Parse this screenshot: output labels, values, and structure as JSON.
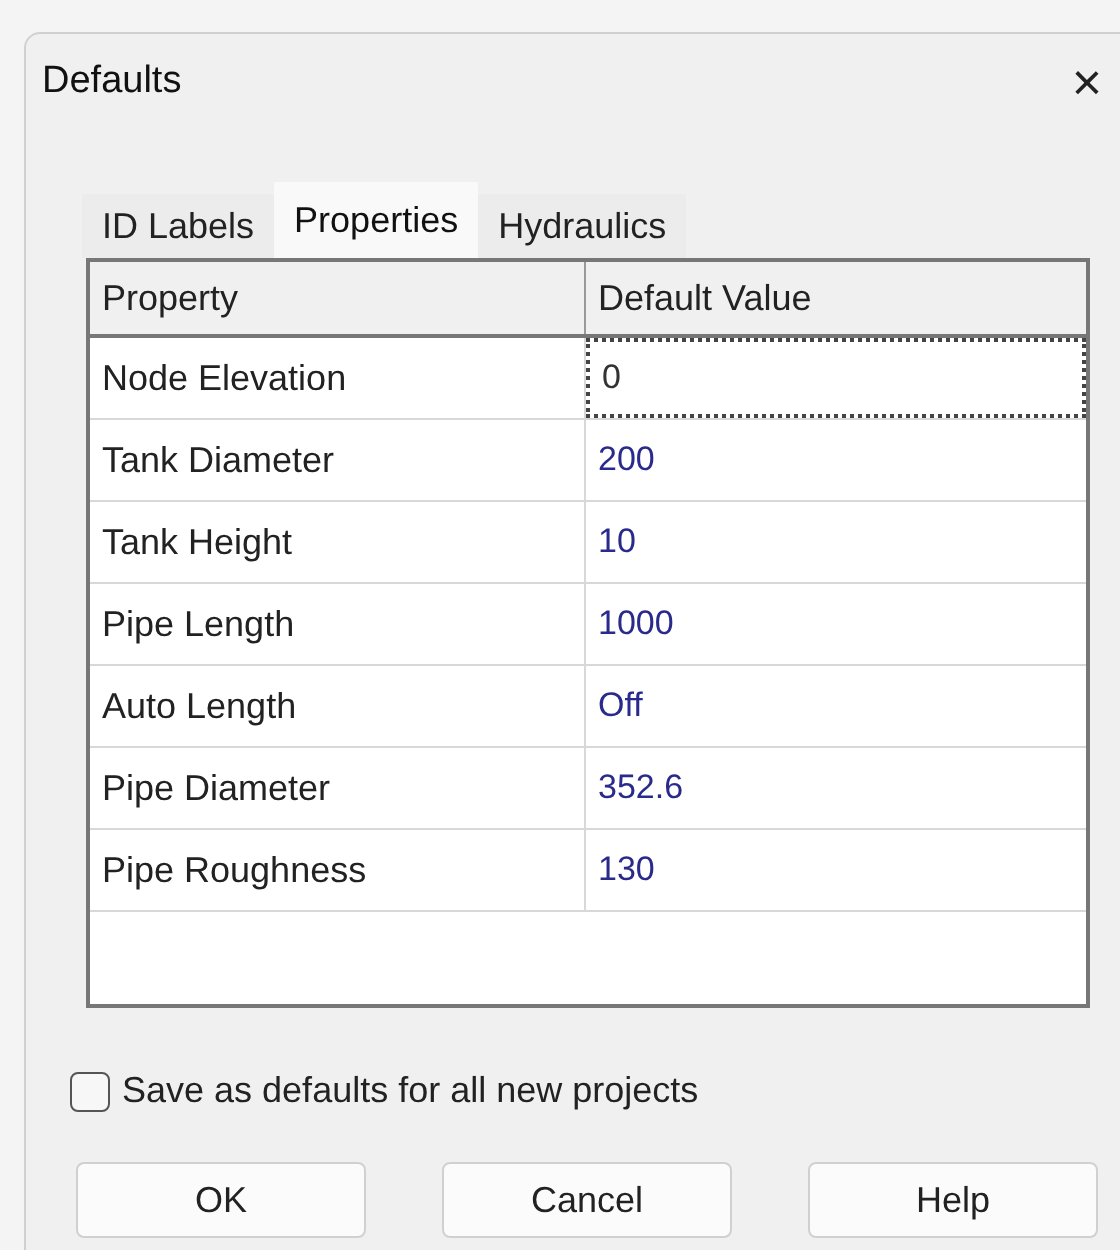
{
  "window": {
    "title": "Defaults",
    "close": "×"
  },
  "tabs": [
    {
      "label": "ID Labels",
      "selected": false
    },
    {
      "label": "Properties",
      "selected": true
    },
    {
      "label": "Hydraulics",
      "selected": false
    }
  ],
  "table": {
    "columns": [
      "Property",
      "Default Value"
    ],
    "rows": [
      {
        "property": "Node Elevation",
        "value": "0",
        "selected": true
      },
      {
        "property": "Tank Diameter",
        "value": "200",
        "selected": false
      },
      {
        "property": "Tank Height",
        "value": "10",
        "selected": false
      },
      {
        "property": "Pipe Length",
        "value": "1000",
        "selected": false
      },
      {
        "property": "Auto Length",
        "value": "Off",
        "selected": false
      },
      {
        "property": "Pipe Diameter",
        "value": "352.6",
        "selected": false
      },
      {
        "property": "Pipe Roughness",
        "value": "130",
        "selected": false
      }
    ]
  },
  "save_defaults": {
    "label": "Save as defaults for all new projects",
    "checked": false
  },
  "buttons": [
    "OK",
    "Cancel",
    "Help"
  ]
}
